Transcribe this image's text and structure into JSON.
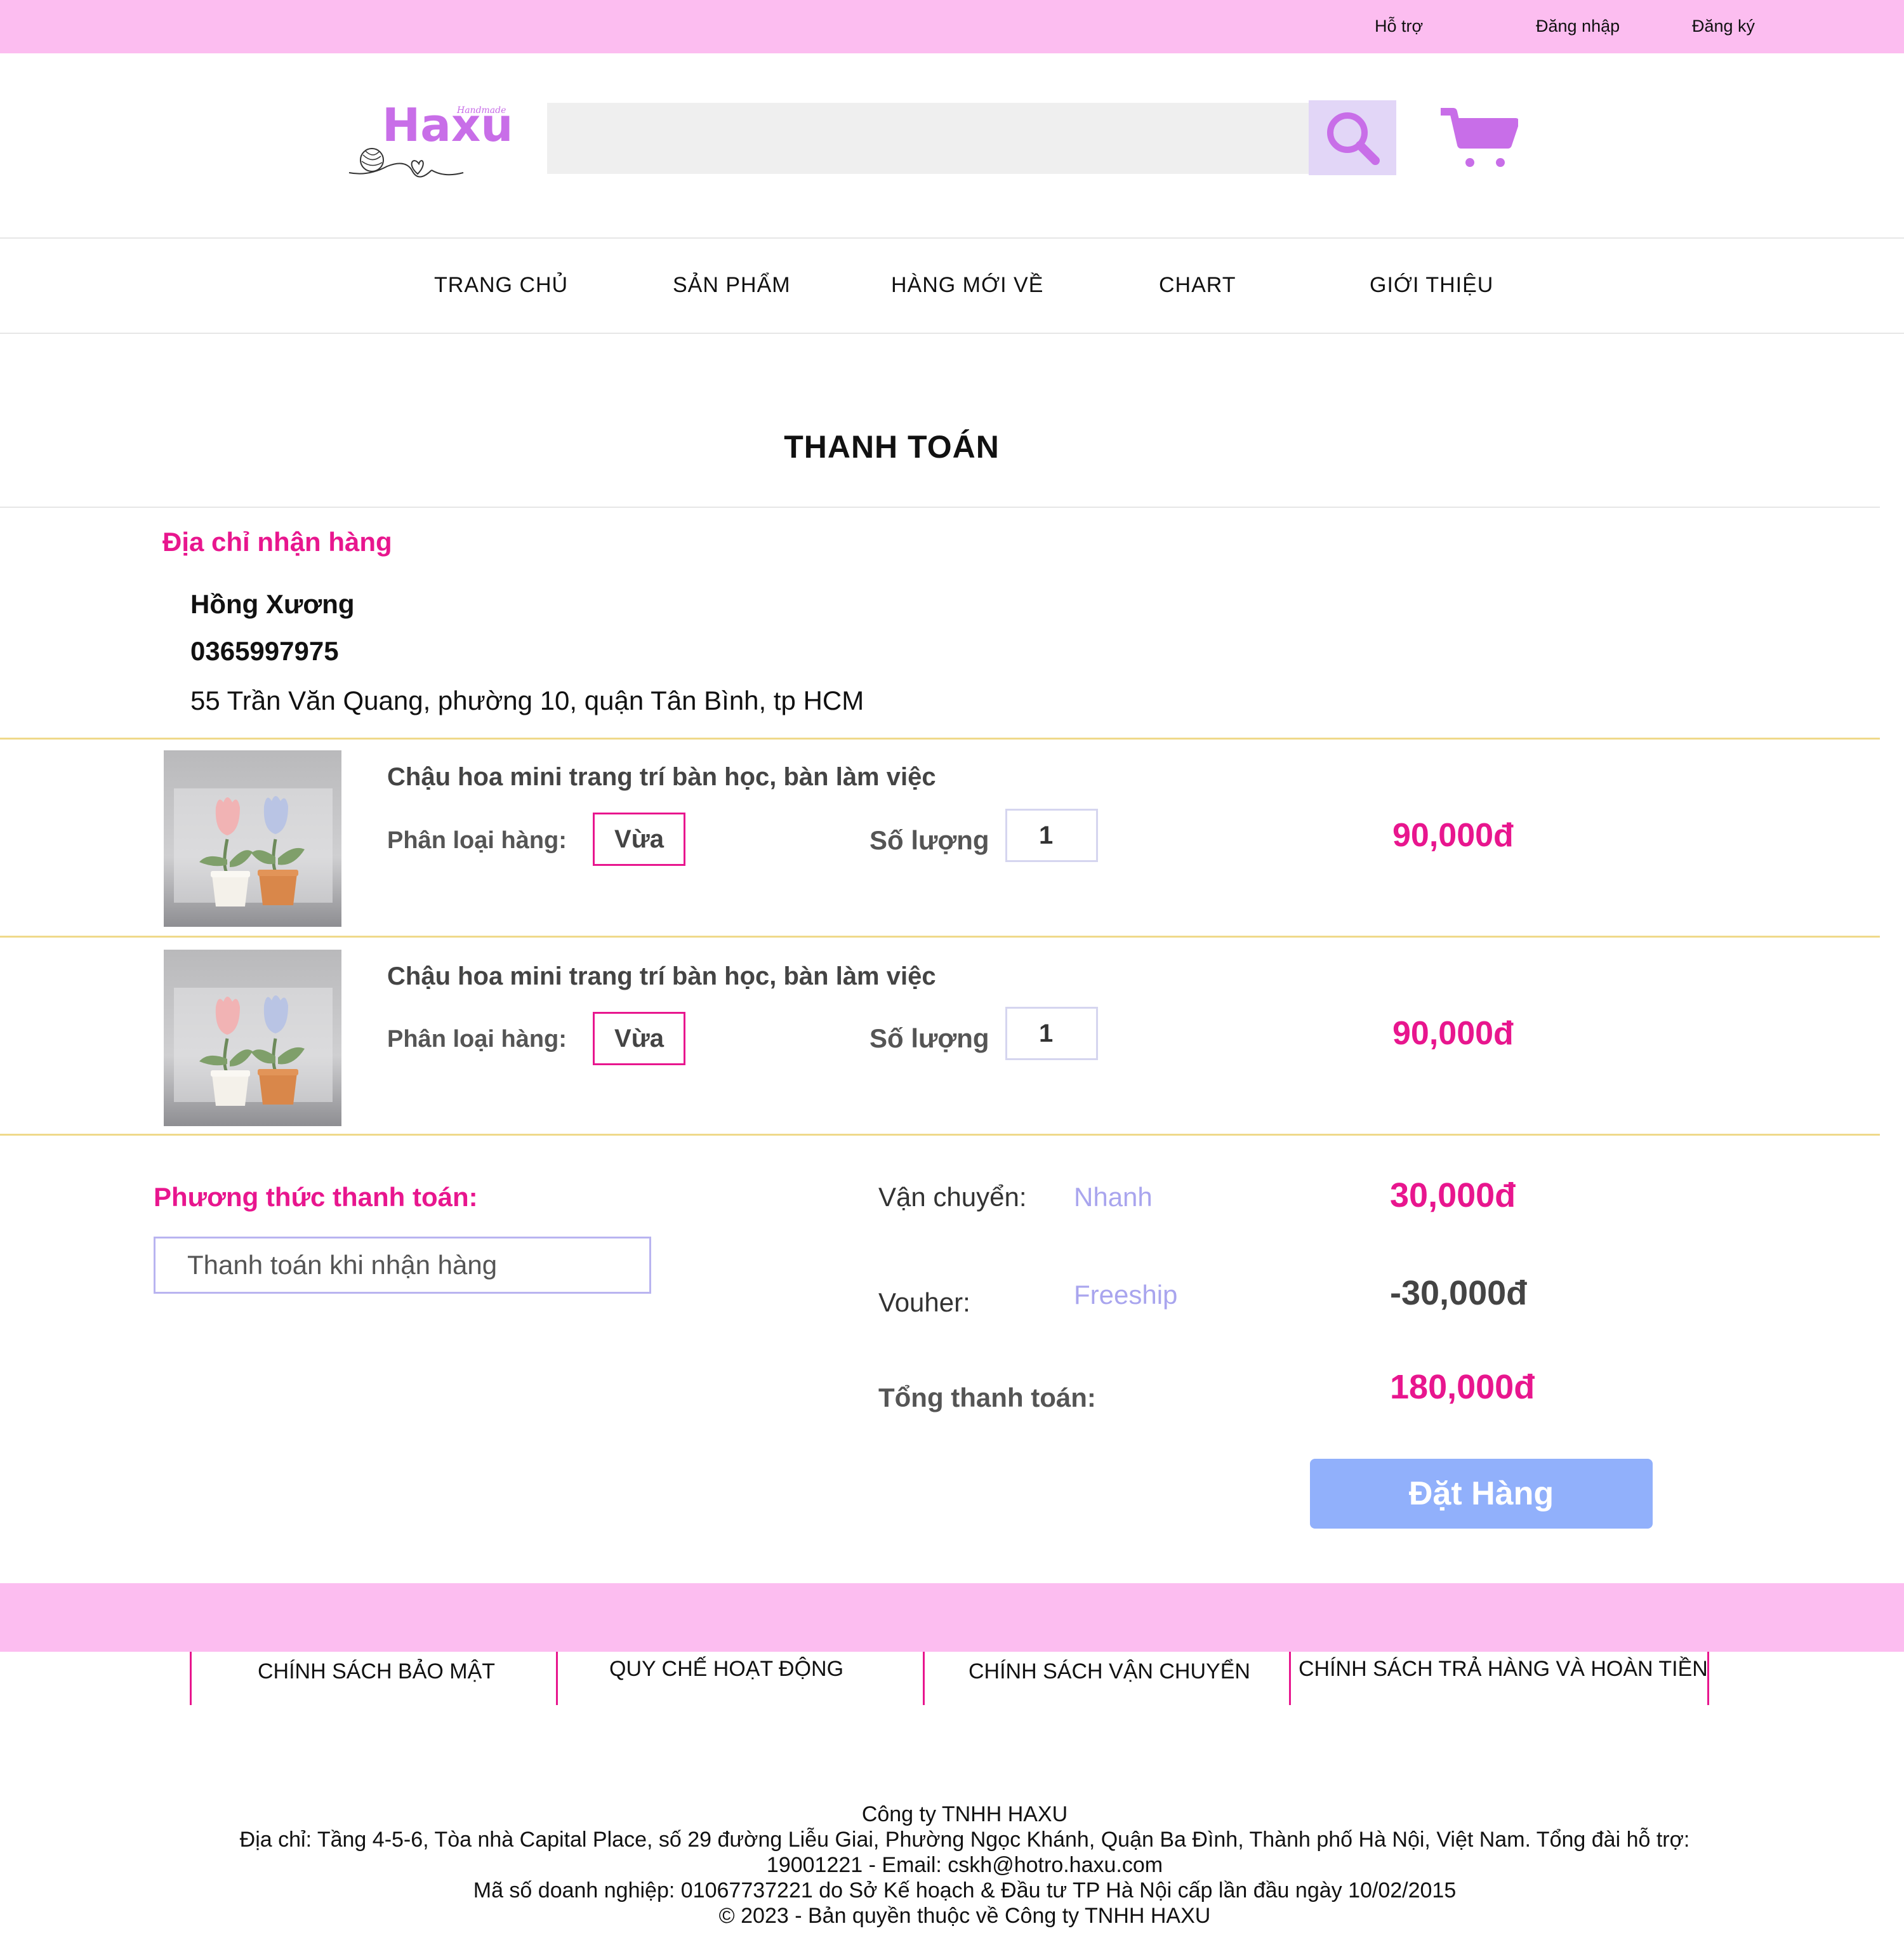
{
  "topbar": {
    "support": "Hỗ trợ",
    "login": "Đăng nhập",
    "register": "Đăng ký"
  },
  "brand": {
    "name": "Haxu",
    "tagline": "Handmade",
    "color": "#c86ee8"
  },
  "search": {
    "placeholder": "",
    "icon": "search-icon"
  },
  "cart": {
    "icon": "cart-icon"
  },
  "nav": {
    "items": [
      "TRANG CHỦ",
      "SẢN PHẨM",
      "HÀNG MỚI VỀ",
      "CHART",
      "GIỚI THIỆU"
    ]
  },
  "page": {
    "title": "THANH TOÁN"
  },
  "address": {
    "title": "Địa chỉ nhận hàng",
    "name": "Hồng Xương",
    "phone": "0365997975",
    "street": "55 Trần Văn Quang, phường 10, quận Tân Bình, tp HCM"
  },
  "items": [
    {
      "name": "Chậu hoa mini trang trí bàn học, bàn làm việc",
      "variant_label": "Phân loại hàng:",
      "variant": "Vừa",
      "qty_label": "Số lượng",
      "qty": "1",
      "price": "90,000đ"
    },
    {
      "name": "Chậu hoa mini trang trí bàn học, bàn làm việc",
      "variant_label": "Phân loại hàng:",
      "variant": "Vừa",
      "qty_label": "Số lượng",
      "qty": "1",
      "price": "90,000đ"
    }
  ],
  "payment": {
    "title": "Phương thức thanh toán:",
    "method": "Thanh toán khi nhận hàng"
  },
  "summary": {
    "shipping_label": "Vận chuyển:",
    "shipping_type": "Nhanh",
    "shipping_amount": "30,000đ",
    "voucher_label": "Vouher:",
    "voucher_type": "Freeship",
    "voucher_amount": "-30,000đ",
    "total_label": "Tổng thanh toán:",
    "total_amount": "180,000đ"
  },
  "order_button": "Đặt Hàng",
  "footer": {
    "links": [
      "CHÍNH SÁCH BẢO MẬT",
      "QUY CHẾ HOẠT ĐỘNG",
      "CHÍNH SÁCH VẬN CHUYỂN",
      "CHÍNH SÁCH TRẢ HÀNG VÀ HOÀN TIỀN"
    ],
    "company": "Công ty TNHH HAXU",
    "address": "Địa chỉ: Tầng 4-5-6, Tòa nhà Capital Place, số 29 đường Liễu Giai, Phường Ngọc Khánh, Quận Ba Đình, Thành phố Hà Nội, Việt Nam. Tổng đài hỗ trợ:",
    "contact": "19001221 - Email: cskh@hotro.haxu.com",
    "tax": "Mã số doanh nghiệp: 01067737221 do Sở Kế hoạch & Đầu tư TP Hà Nội cấp lần đầu ngày 10/02/2015",
    "copyright": "© 2023 - Bản quyền thuộc về Công ty TNHH HAXU"
  },
  "colors": {
    "topbar": "#fcbdf0",
    "accent": "#e8168e",
    "button": "#91b0fb",
    "divider": "#efd98a"
  }
}
